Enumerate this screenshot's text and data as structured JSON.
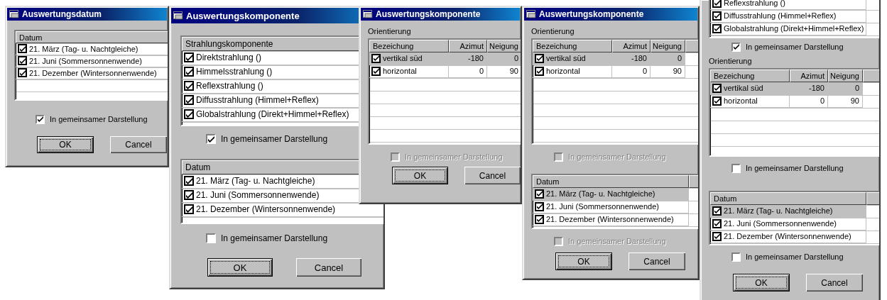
{
  "windows": [
    {
      "title": "Auswertungsdatum",
      "sections": [
        {
          "kind": "list",
          "columns": [
            "Datum"
          ],
          "rows": [
            {
              "cells": [
                "21. März (Tag- u. Nachtgleiche)"
              ],
              "checked": true,
              "selected": false
            },
            {
              "cells": [
                "21. Juni (Sommersonnenwende)"
              ],
              "checked": true,
              "selected": false
            },
            {
              "cells": [
                "21. Dezember (Wintersonnenwende)"
              ],
              "checked": true,
              "selected": false
            }
          ]
        },
        {
          "kind": "checkbox",
          "label": "In gemeinsamer Darstellung",
          "checked": true,
          "disabled": false
        }
      ],
      "buttons": [
        {
          "label": "OK",
          "default": true
        },
        {
          "label": "Cancel",
          "default": false
        }
      ]
    },
    {
      "title": "Auswertungskomponente",
      "sections": [
        {
          "kind": "list",
          "columns": [
            "Strahlungskomponente"
          ],
          "rows": [
            {
              "cells": [
                "Direktstrahlung ()"
              ],
              "checked": true,
              "selected": false
            },
            {
              "cells": [
                "Himmelsstrahlung ()"
              ],
              "checked": true,
              "selected": false
            },
            {
              "cells": [
                "Reflexstrahlung ()"
              ],
              "checked": true,
              "selected": false
            },
            {
              "cells": [
                "Diffusstrahlung (Himmel+Reflex)"
              ],
              "checked": true,
              "selected": false
            },
            {
              "cells": [
                "Globalstrahlung (Direkt+Himmel+Reflex)"
              ],
              "checked": true,
              "selected": false
            }
          ]
        },
        {
          "kind": "checkbox",
          "label": "In gemeinsamer Darstellung",
          "checked": true,
          "disabled": false
        },
        {
          "kind": "list",
          "columns": [
            "Datum"
          ],
          "rows": [
            {
              "cells": [
                "21. März (Tag- u. Nachtgleiche)"
              ],
              "checked": true,
              "selected": false
            },
            {
              "cells": [
                "21. Juni (Sommersonnenwende)"
              ],
              "checked": true,
              "selected": false
            },
            {
              "cells": [
                "21. Dezember (Wintersonnenwende)"
              ],
              "checked": true,
              "selected": false
            }
          ]
        },
        {
          "kind": "checkbox",
          "label": "In gemeinsamer Darstellung",
          "checked": false,
          "disabled": false
        }
      ],
      "buttons": [
        {
          "label": "OK",
          "default": true
        },
        {
          "label": "Cancel",
          "default": false
        }
      ]
    },
    {
      "title": "Auswertungskomponente",
      "sections": [
        {
          "kind": "label",
          "text": "Orientierung"
        },
        {
          "kind": "list",
          "columns": [
            "Bezeichung",
            "Azimut",
            "Neigung"
          ],
          "rows": [
            {
              "cells": [
                "vertikal süd",
                "-180",
                "0"
              ],
              "checked": true,
              "selected": true
            },
            {
              "cells": [
                "horizontal",
                "0",
                "90"
              ],
              "checked": true,
              "selected": false
            }
          ]
        },
        {
          "kind": "checkbox",
          "label": "In gemeinsamer Darstellung",
          "checked": false,
          "disabled": true
        }
      ],
      "buttons": [
        {
          "label": "OK",
          "default": true
        },
        {
          "label": "Cancel",
          "default": false
        }
      ]
    },
    {
      "title": "Auswertungskomponente",
      "sections": [
        {
          "kind": "label",
          "text": "Orientierung"
        },
        {
          "kind": "list",
          "columns": [
            "Bezeichung",
            "Azimut",
            "Neigung"
          ],
          "rows": [
            {
              "cells": [
                "vertikal süd",
                "-180",
                "0"
              ],
              "checked": true,
              "selected": true
            },
            {
              "cells": [
                "horizontal",
                "0",
                "90"
              ],
              "checked": true,
              "selected": false
            }
          ]
        },
        {
          "kind": "checkbox",
          "label": "In gemeinsamer Darstellung",
          "checked": false,
          "disabled": true
        },
        {
          "kind": "list",
          "columns": [
            "Datum"
          ],
          "rows": [
            {
              "cells": [
                "21. März (Tag- u. Nachtgleiche)"
              ],
              "checked": true,
              "selected": true
            },
            {
              "cells": [
                "21. Juni (Sommersonnenwende)"
              ],
              "checked": true,
              "selected": false
            },
            {
              "cells": [
                "21. Dezember (Wintersonnenwende)"
              ],
              "checked": true,
              "selected": false
            }
          ]
        },
        {
          "kind": "checkbox",
          "label": "In gemeinsamer Darstellung",
          "checked": false,
          "disabled": true
        }
      ],
      "buttons": [
        {
          "label": "OK",
          "default": true
        },
        {
          "label": "Cancel",
          "default": false
        }
      ]
    },
    {
      "sections": [
        {
          "kind": "list",
          "rows": [
            {
              "cells": [
                "Reflexstrahlung ()"
              ],
              "checked": true,
              "selected": false
            },
            {
              "cells": [
                "Diffusstrahlung (Himmel+Reflex)"
              ],
              "checked": true,
              "selected": false
            },
            {
              "cells": [
                "Globalstrahlung (Direkt+Himmel+Reflex)"
              ],
              "checked": true,
              "selected": false
            }
          ]
        },
        {
          "kind": "checkbox",
          "label": "In gemeinsamer Darstellung",
          "checked": true,
          "disabled": false
        },
        {
          "kind": "label",
          "text": "Orientierung"
        },
        {
          "kind": "list",
          "columns": [
            "Bezeichung",
            "Azimut",
            "Neigung"
          ],
          "rows": [
            {
              "cells": [
                "vertikal süd",
                "-180",
                "0"
              ],
              "checked": true,
              "selected": true
            },
            {
              "cells": [
                "horizontal",
                "0",
                "90"
              ],
              "checked": true,
              "selected": false
            }
          ]
        },
        {
          "kind": "checkbox",
          "label": "In gemeinsamer Darstellung",
          "checked": false,
          "disabled": false
        },
        {
          "kind": "list",
          "columns": [
            "Datum"
          ],
          "rows": [
            {
              "cells": [
                "21. März (Tag- u. Nachtgleiche)"
              ],
              "checked": true,
              "selected": true
            },
            {
              "cells": [
                "21. Juni (Sommersonnenwende)"
              ],
              "checked": true,
              "selected": false
            },
            {
              "cells": [
                "21. Dezember (Wintersonnenwende)"
              ],
              "checked": true,
              "selected": false
            }
          ]
        },
        {
          "kind": "checkbox",
          "label": "In gemeinsamer Darstellung",
          "checked": false,
          "disabled": false
        }
      ],
      "buttons": [
        {
          "label": "OK",
          "default": true
        },
        {
          "label": "Cancel",
          "default": false
        }
      ]
    }
  ]
}
